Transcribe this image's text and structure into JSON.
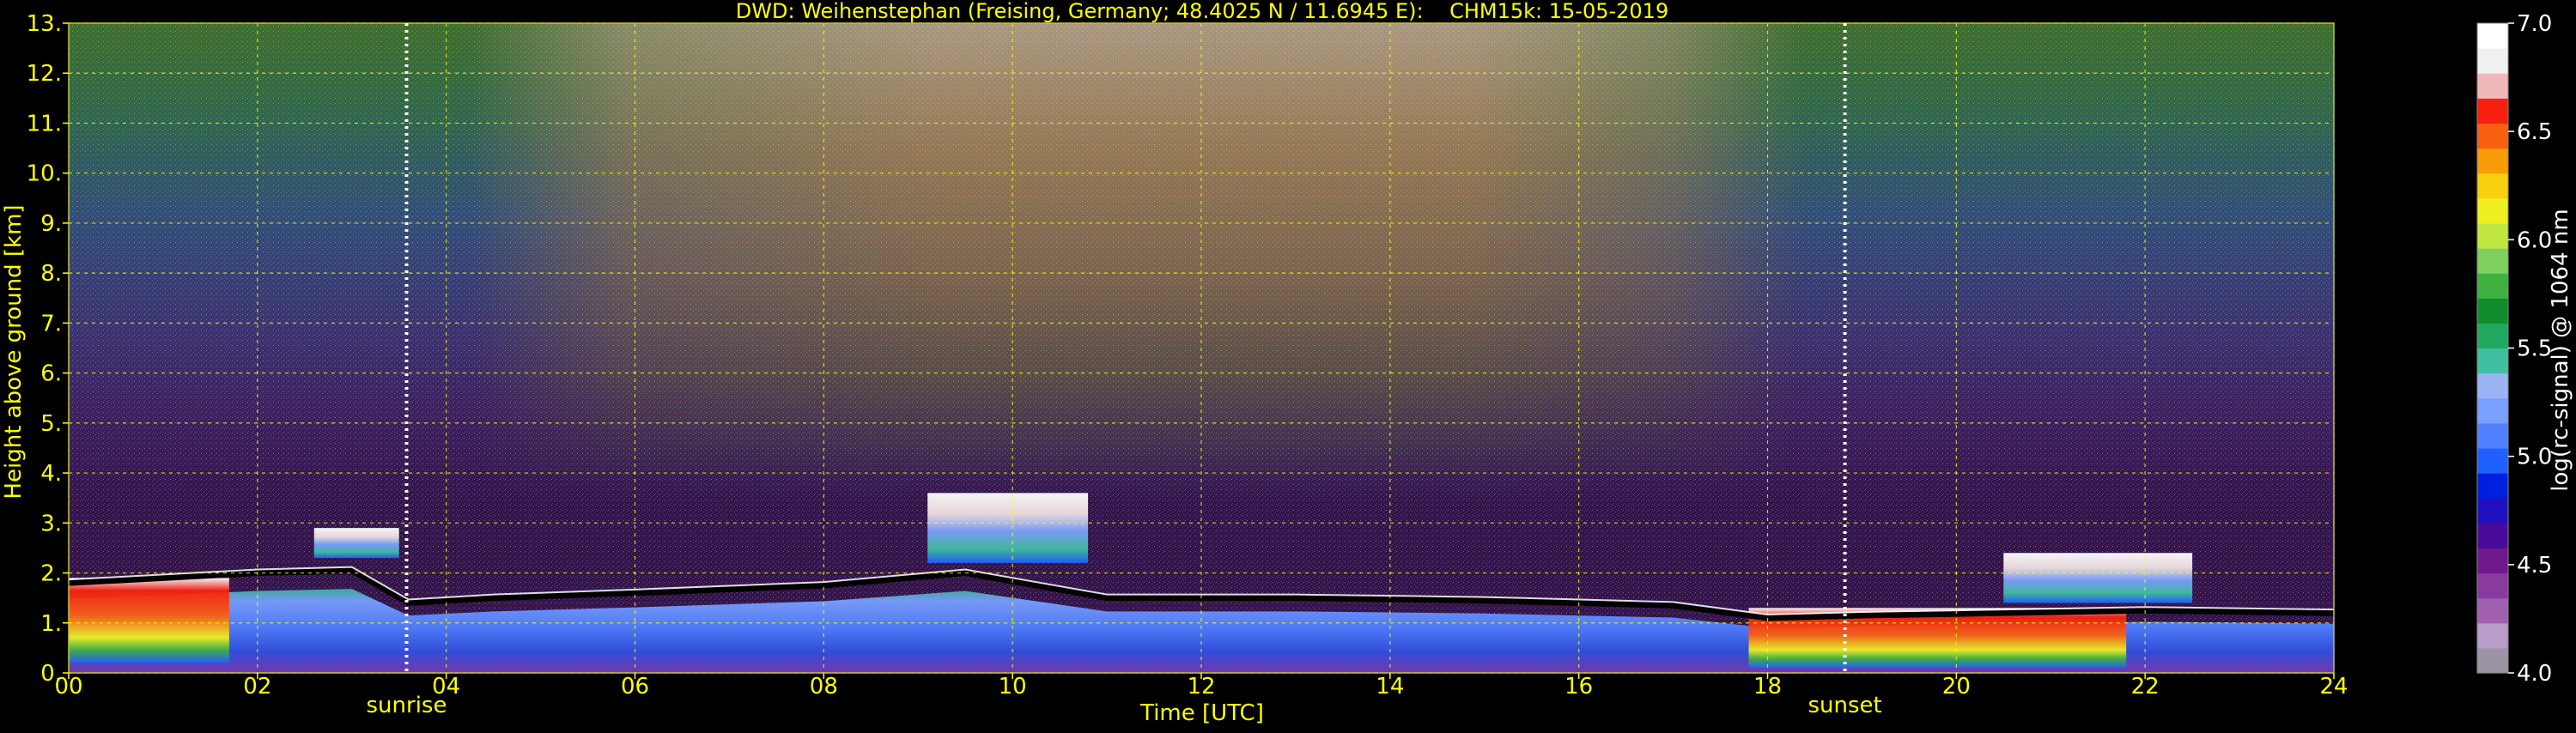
{
  "colors": {
    "background": "#000000",
    "text": "#ffff00",
    "colorbar_text": "#ffffff",
    "grid": "#ffff00",
    "sun_marker": "#ffffff"
  },
  "chart_data": {
    "type": "heatmap",
    "title": "DWD: Weihenstephan (Freising, Germany; 48.4025 N / 11.6945 E):    CHM15k: 15-05-2019",
    "xlabel": "Time [UTC]",
    "ylabel": "Height above ground [km]",
    "xlim": [
      0,
      24
    ],
    "ylim": [
      0,
      13
    ],
    "x_ticks": [
      0,
      2,
      4,
      6,
      8,
      10,
      12,
      14,
      16,
      18,
      20,
      22,
      24
    ],
    "x_tick_labels": [
      "00",
      "02",
      "04",
      "06",
      "08",
      "10",
      "12",
      "14",
      "16",
      "18",
      "20",
      "22",
      "24"
    ],
    "y_ticks": [
      0,
      1,
      2,
      3,
      4,
      5,
      6,
      7,
      8,
      9,
      10,
      11,
      12,
      13
    ],
    "y_tick_labels": [
      "0.",
      "1.",
      "2.",
      "3.",
      "4.",
      "5.",
      "6.",
      "7.",
      "8.",
      "9.",
      "10.",
      "11.",
      "12.",
      "13."
    ],
    "grid": true,
    "annotations": [
      {
        "label": "sunrise",
        "x": 3.58
      },
      {
        "label": "sunset",
        "x": 18.82
      }
    ],
    "colorbar": {
      "label": "log(rc-signal) @ 1064 nm",
      "range": [
        4.0,
        7.0
      ],
      "ticks": [
        4.0,
        4.5,
        5.0,
        5.5,
        6.0,
        6.5,
        7.0
      ],
      "tick_labels": [
        "4.0",
        "4.5",
        "5.0",
        "5.5",
        "6.0",
        "6.5",
        "7.0"
      ],
      "colors": [
        "#9c94a4",
        "#b89ec8",
        "#a060b0",
        "#8a3a9e",
        "#6e1a8c",
        "#4a0a9a",
        "#2010c0",
        "#0020e0",
        "#2060ff",
        "#5080ff",
        "#7aa0ff",
        "#9cb4f4",
        "#40c0a0",
        "#20a860",
        "#108c2c",
        "#40b040",
        "#80d060",
        "#c0e840",
        "#f0f020",
        "#f8d010",
        "#f89c08",
        "#f86010",
        "#f82010",
        "#f0b8b8",
        "#f0f0f0",
        "#ffffff"
      ]
    },
    "cloud_base_km": [
      [
        0.0,
        1.8
      ],
      [
        1.0,
        1.9
      ],
      [
        2.0,
        2.0
      ],
      [
        3.0,
        2.05
      ],
      [
        3.6,
        1.4
      ],
      [
        4.5,
        1.5
      ],
      [
        6.0,
        1.6
      ],
      [
        8.0,
        1.75
      ],
      [
        9.5,
        2.0
      ],
      [
        11.0,
        1.5
      ],
      [
        13.0,
        1.5
      ],
      [
        15.0,
        1.45
      ],
      [
        17.0,
        1.35
      ],
      [
        18.0,
        1.1
      ],
      [
        19.0,
        1.15
      ],
      [
        20.5,
        1.2
      ],
      [
        22.0,
        1.25
      ],
      [
        24.0,
        1.2
      ]
    ],
    "features": [
      {
        "kind": "cloud_layer",
        "x_start": 0.0,
        "x_end": 1.7,
        "y_bottom": 0.2,
        "y_top": 1.9
      },
      {
        "kind": "cloud_layer",
        "x_start": 2.6,
        "x_end": 3.5,
        "y_bottom": 2.3,
        "y_top": 2.9
      },
      {
        "kind": "cloud_layer",
        "x_start": 9.1,
        "x_end": 10.8,
        "y_bottom": 2.2,
        "y_top": 3.6
      },
      {
        "kind": "cloud_layer",
        "x_start": 17.8,
        "x_end": 21.8,
        "y_bottom": 0.1,
        "y_top": 1.3
      },
      {
        "kind": "cloud_layer",
        "x_start": 20.5,
        "x_end": 22.5,
        "y_bottom": 1.4,
        "y_top": 2.4
      }
    ]
  }
}
